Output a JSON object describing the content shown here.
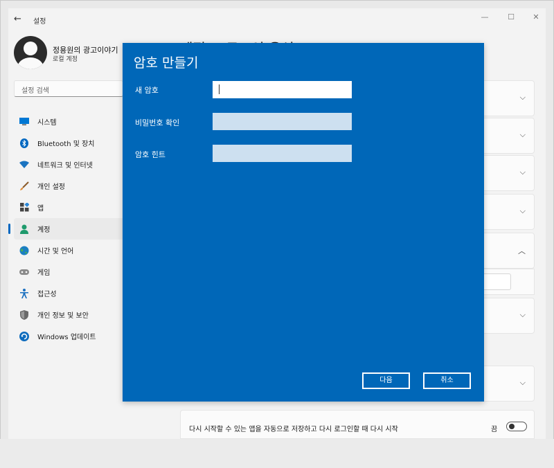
{
  "window": {
    "title": "설정",
    "back_icon": "←",
    "minimize_icon": "—",
    "maximize_icon": "☐",
    "close_icon": "✕"
  },
  "profile": {
    "name": "정용원의 광고이야기",
    "account_type": "로컬 계정"
  },
  "search": {
    "placeholder": "설정 검색"
  },
  "sidebar": {
    "items": [
      {
        "label": "시스템",
        "icon": "system-icon",
        "color": "#0078d4"
      },
      {
        "label": "Bluetooth 및 장치",
        "icon": "bluetooth-icon",
        "color": "#0067c0"
      },
      {
        "label": "네트워크 및 인터넷",
        "icon": "wifi-icon",
        "color": "#1a73c0"
      },
      {
        "label": "개인 설정",
        "icon": "brush-icon",
        "color": "#d07a2a"
      },
      {
        "label": "앱",
        "icon": "apps-icon",
        "color": "#444444"
      },
      {
        "label": "계정",
        "icon": "account-icon",
        "color": "#1e9a6c",
        "active": true
      },
      {
        "label": "시간 및 언어",
        "icon": "globe-icon",
        "color": "#1b7fc1"
      },
      {
        "label": "게임",
        "icon": "gamepad-icon",
        "color": "#777777"
      },
      {
        "label": "접근성",
        "icon": "accessibility-icon",
        "color": "#1a6fbf"
      },
      {
        "label": "개인 정보 및 보안",
        "icon": "shield-icon",
        "color": "#6a6a6a"
      },
      {
        "label": "Windows 업데이트",
        "icon": "update-icon",
        "color": "#0f6cbd"
      }
    ]
  },
  "content": {
    "title": "계정 > 로그인 옵션",
    "restart_text": "다시 시작할 수 있는 앱을 자동으로 저장하고 다시 로그인할 때 다시 시작",
    "toggle_label": "끔"
  },
  "dialog": {
    "title": "암호 만들기",
    "fields": [
      {
        "label": "새 암호",
        "value": ""
      },
      {
        "label": "비밀번호 확인",
        "value": ""
      },
      {
        "label": "암호 힌트",
        "value": ""
      }
    ],
    "next_label": "다음",
    "cancel_label": "취소",
    "background_color": "#0067b8"
  }
}
